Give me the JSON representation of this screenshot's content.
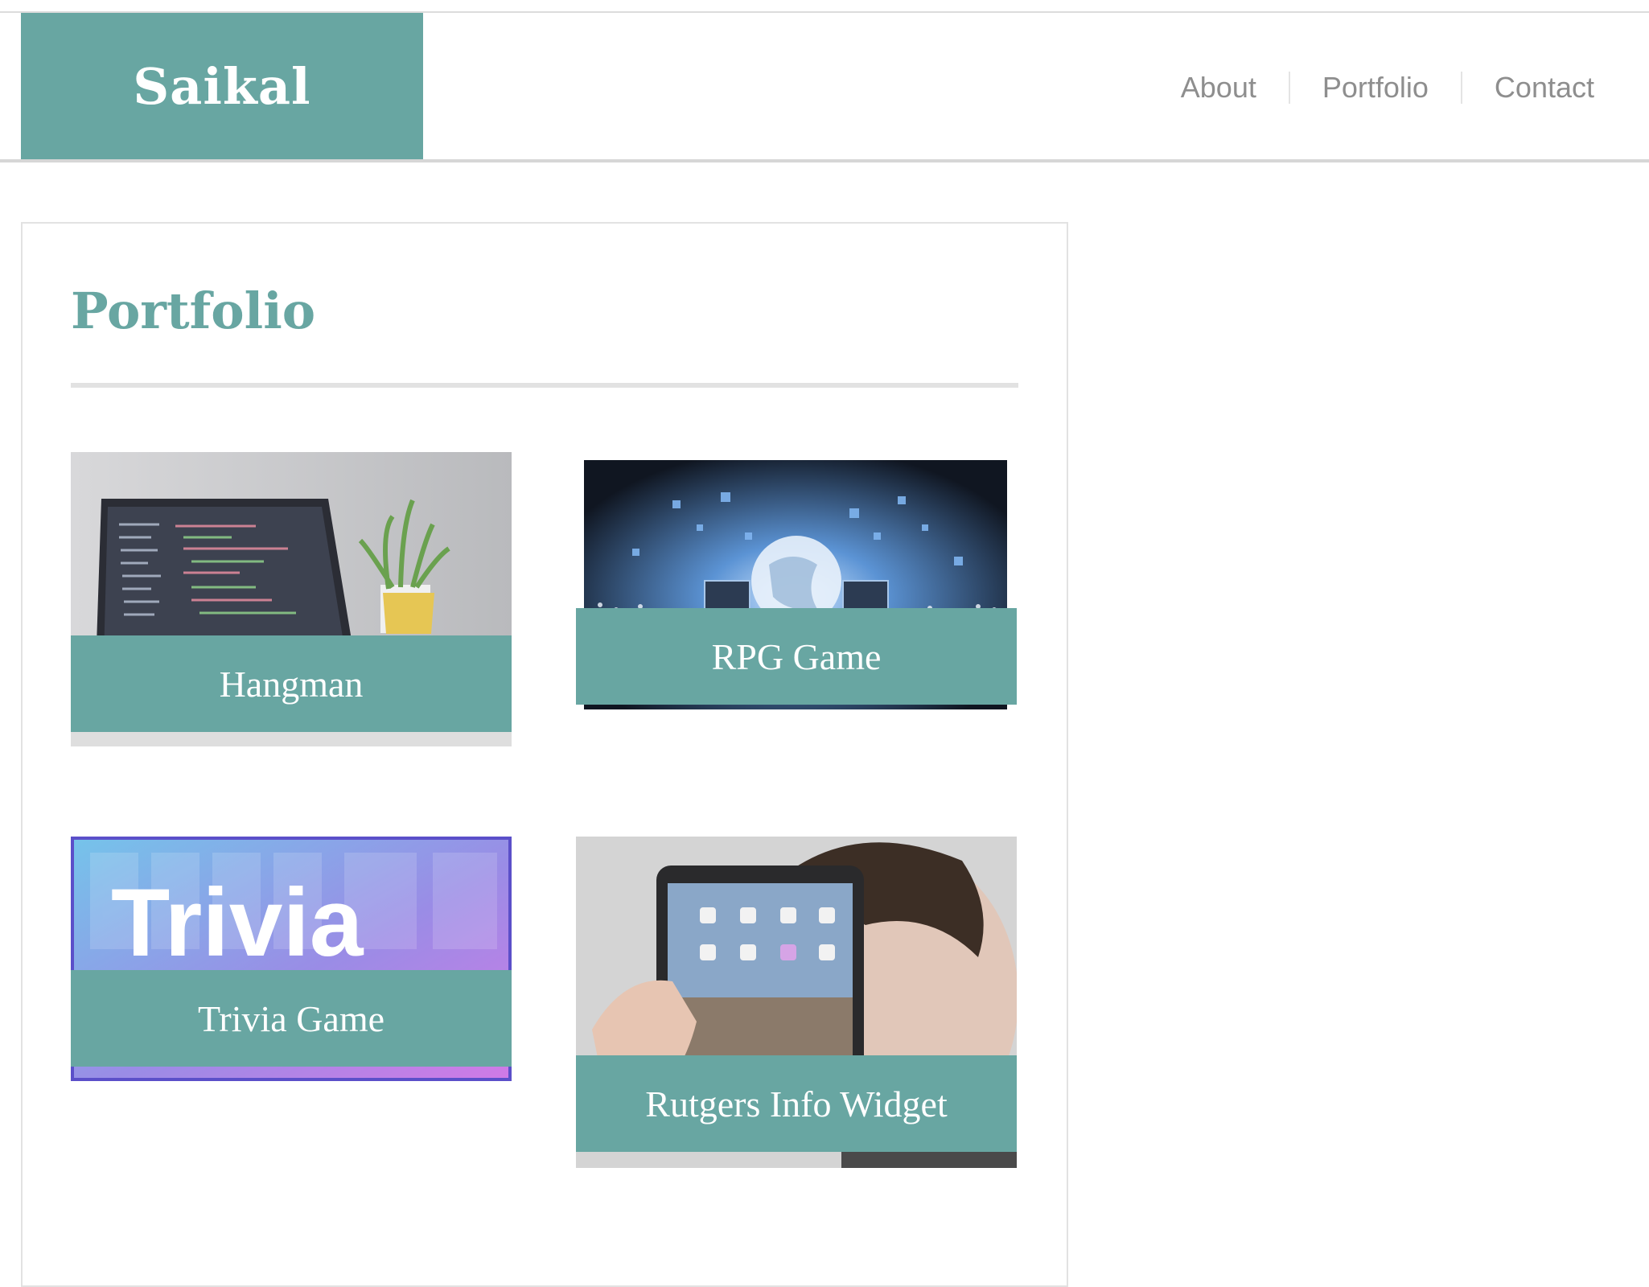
{
  "header": {
    "logo": "Saikal",
    "nav": [
      "About",
      "Portfolio",
      "Contact"
    ]
  },
  "portfolio": {
    "title": "Portfolio",
    "items": [
      {
        "title": "Hangman",
        "image": "laptop-with-code"
      },
      {
        "title": "RPG Game",
        "image": "globe-network"
      },
      {
        "title": "Trivia Game",
        "image": "trivia-banner",
        "image_text": "Trivia"
      },
      {
        "title": "Rutgers Info Widget",
        "image": "person-holding-tablet"
      }
    ]
  },
  "colors": {
    "accent": "#68a6a2",
    "nav_text": "#8e8e8e",
    "border": "#e2e2e2"
  }
}
